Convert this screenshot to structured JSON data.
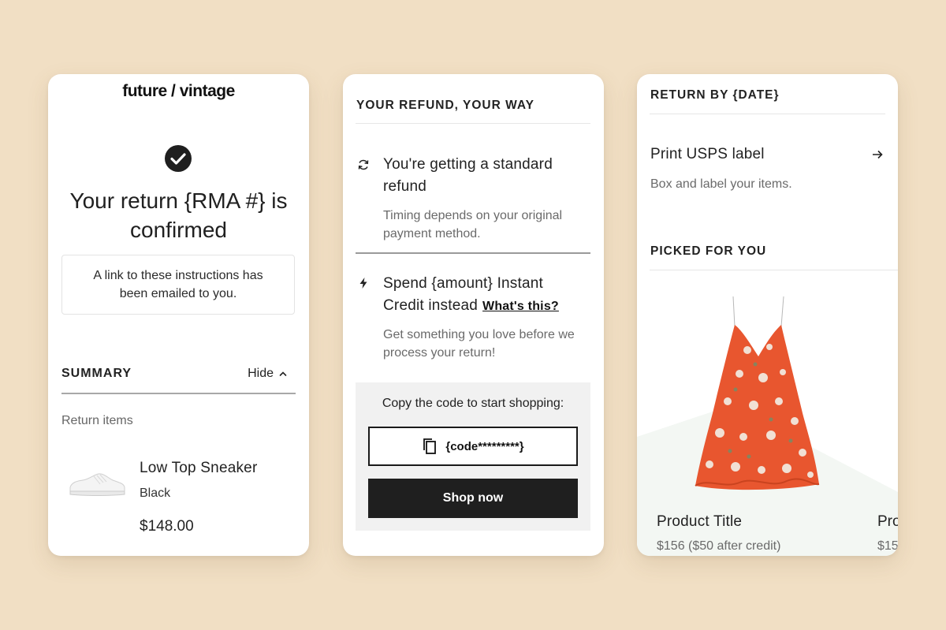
{
  "card1": {
    "logo": "future / vintage",
    "title": "Your return {RMA #} is confirmed",
    "email_notice": "A link to these instructions has been emailed to you.",
    "summary": {
      "title": "SUMMARY",
      "toggle_label": "Hide"
    },
    "return_items_label": "Return items",
    "item": {
      "name": "Low Top Sneaker",
      "color": "Black",
      "price": "$148.00"
    }
  },
  "card2": {
    "section_title": "YOUR REFUND, YOUR WAY",
    "standard": {
      "icon": "refresh-icon",
      "title": "You're getting a standard refund",
      "desc": "Timing depends on your original payment method."
    },
    "credit": {
      "icon": "lightning-icon",
      "title": "Spend {amount} Instant Credit instead",
      "link": "What's this?",
      "desc": "Get something you love before we process your return!"
    },
    "code_panel": {
      "label": "Copy the code to start shopping:",
      "code": "{code*********}",
      "shop_button": "Shop now"
    }
  },
  "card3": {
    "return_by_title": "RETURN BY {DATE}",
    "print_label": "Print USPS label",
    "print_desc": "Box and label your items.",
    "picked_title": "PICKED FOR YOU",
    "products": [
      {
        "title": "Product Title",
        "price": "$156 ($50 after credit)"
      },
      {
        "title": "Pro",
        "price": "$15"
      }
    ]
  },
  "colors": {
    "background": "#f1dfc4",
    "button_dark": "#1f1f1f",
    "dress_orange": "#e8562f"
  }
}
